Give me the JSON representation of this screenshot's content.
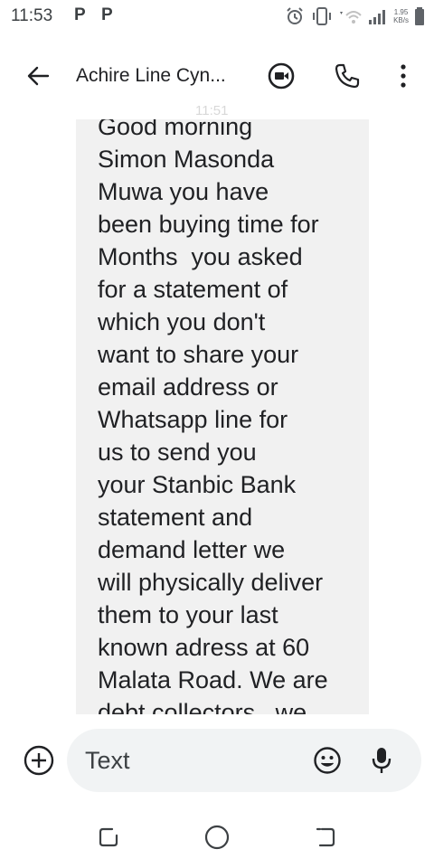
{
  "status_bar": {
    "time": "11:53",
    "notification_icons": [
      "P",
      "P"
    ],
    "net_speed_value": "1.95",
    "net_speed_unit": "KB/s",
    "icons": [
      "alarm-icon",
      "vibrate-icon",
      "wifi-icon",
      "signal-icon",
      "battery-icon"
    ]
  },
  "app_bar": {
    "title": "Achire Line Cyn...",
    "ghost_time": "11:51",
    "icons": [
      "back-arrow-icon",
      "video-call-icon",
      "phone-icon",
      "more-vert-icon"
    ]
  },
  "message": {
    "lines": [
      "Good morning",
      "Simon Masonda",
      "Muwa you have",
      "been buying time for",
      "Months  you asked",
      "for a statement of",
      "which you don't",
      "want to share your",
      "email address or",
      "Whatsapp line for",
      "us to send you",
      "your Stanbic Bank",
      "statement and",
      "demand letter we",
      "will physically deliver",
      "them to your last",
      "known adress at 60",
      "Malata Road. We are",
      "debt collectors , we"
    ]
  },
  "composer": {
    "placeholder": "Text",
    "icons": [
      "add-circle-icon",
      "emoji-icon",
      "mic-icon"
    ]
  },
  "nav_bar": {
    "icons": [
      "recents-icon",
      "home-icon",
      "back-icon"
    ]
  },
  "colors": {
    "bubble": "#f1f1f1",
    "input_pill": "#f1f3f4",
    "text": "#202124"
  }
}
